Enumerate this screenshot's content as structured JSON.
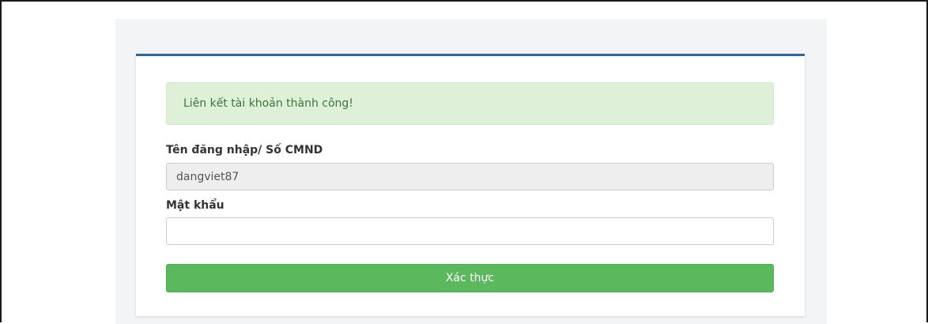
{
  "alert": {
    "message": "Liên kết tài khoản thành công!",
    "color": "#3c763d",
    "background": "#dff0d8"
  },
  "form": {
    "username_label": "Tên đăng nhập/ Số CMND",
    "username_value": "dangviet87",
    "password_label": "Mật khẩu",
    "password_value": "",
    "submit_label": "Xác thực"
  },
  "colors": {
    "accent_border": "#2c6797",
    "submit_button": "#5cb85c"
  }
}
